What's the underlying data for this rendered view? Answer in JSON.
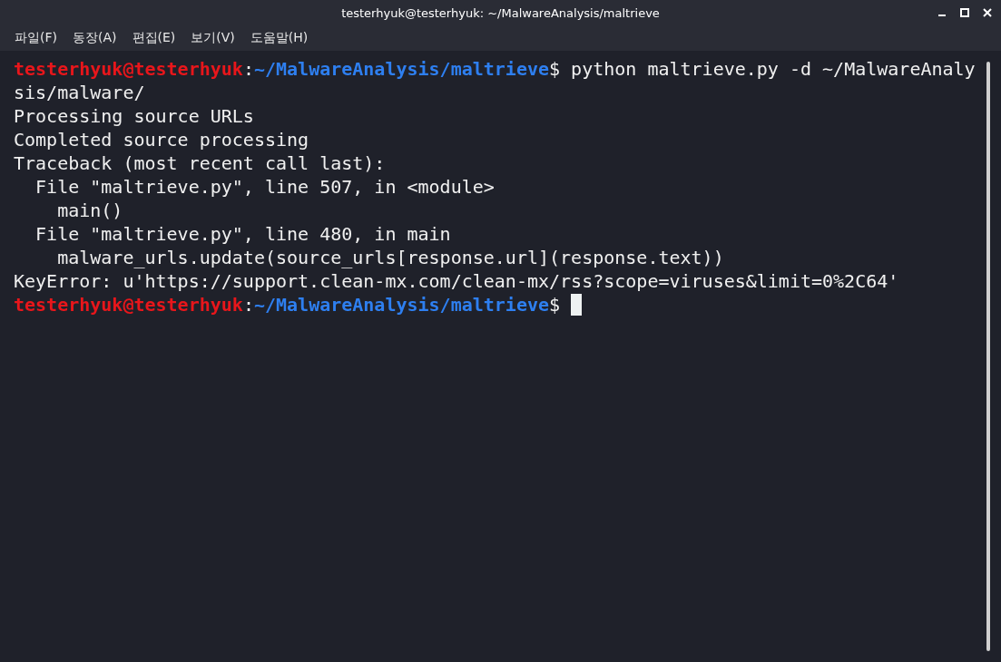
{
  "window": {
    "title": "testerhyuk@testerhyuk: ~/MalwareAnalysis/maltrieve"
  },
  "menu": [
    "파일(F)",
    "동장(A)",
    "편집(E)",
    "보기(V)",
    "도움말(H)"
  ],
  "terminal": {
    "lines": [
      {
        "kind": "prompt",
        "user": "testerhyuk@testerhyuk",
        "separator": ":",
        "path": "~/MalwareAnalysis/maltrieve",
        "command": "$ python maltrieve.py -d ~/MalwareAnaly",
        "cursor": false
      },
      {
        "kind": "output",
        "text": "sis/malware/"
      },
      {
        "kind": "output",
        "text": "Processing source URLs"
      },
      {
        "kind": "output",
        "text": "Completed source processing"
      },
      {
        "kind": "output",
        "text": "Traceback (most recent call last):"
      },
      {
        "kind": "output",
        "text": "  File \"maltrieve.py\", line 507, in <module>"
      },
      {
        "kind": "output",
        "text": "    main()"
      },
      {
        "kind": "output",
        "text": "  File \"maltrieve.py\", line 480, in main"
      },
      {
        "kind": "output",
        "text": "    malware_urls.update(source_urls[response.url](response.text))"
      },
      {
        "kind": "output",
        "text": "KeyError: u'https://support.clean-mx.com/clean-mx/rss?scope=viruses&limit=0%2C64'"
      },
      {
        "kind": "prompt",
        "user": "testerhyuk@testerhyuk",
        "separator": ":",
        "path": "~/MalwareAnalysis/maltrieve",
        "command": "$ ",
        "cursor": true
      }
    ]
  }
}
